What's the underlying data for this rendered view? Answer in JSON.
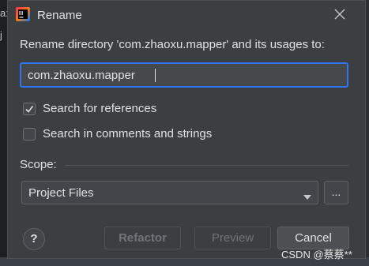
{
  "background": {
    "left_fragments": [
      "a:",
      "j"
    ]
  },
  "dialog": {
    "title": "Rename",
    "description": "Rename directory 'com.zhaoxu.mapper' and its usages to:",
    "input_value": "com.zhaoxu.mapper",
    "options": [
      {
        "label": "Search for references",
        "checked": true
      },
      {
        "label": "Search in comments and strings",
        "checked": false
      }
    ],
    "scope": {
      "label": "Scope:",
      "selected": "Project Files",
      "more_label": "..."
    },
    "buttons": {
      "help": "?",
      "refactor": "Refactor",
      "preview": "Preview",
      "cancel": "Cancel"
    }
  },
  "watermark": "CSDN @蔡蔡**",
  "colors": {
    "accent": "#3574f0",
    "dialog_bg": "#3c3f41",
    "text": "#dfe1e5",
    "disabled_text": "#6f737a"
  },
  "icons": {
    "app": "intellij-idea-icon",
    "close": "close-icon",
    "check": "checkmark-icon",
    "dropdown": "chevron-down-icon",
    "help": "question-icon"
  }
}
